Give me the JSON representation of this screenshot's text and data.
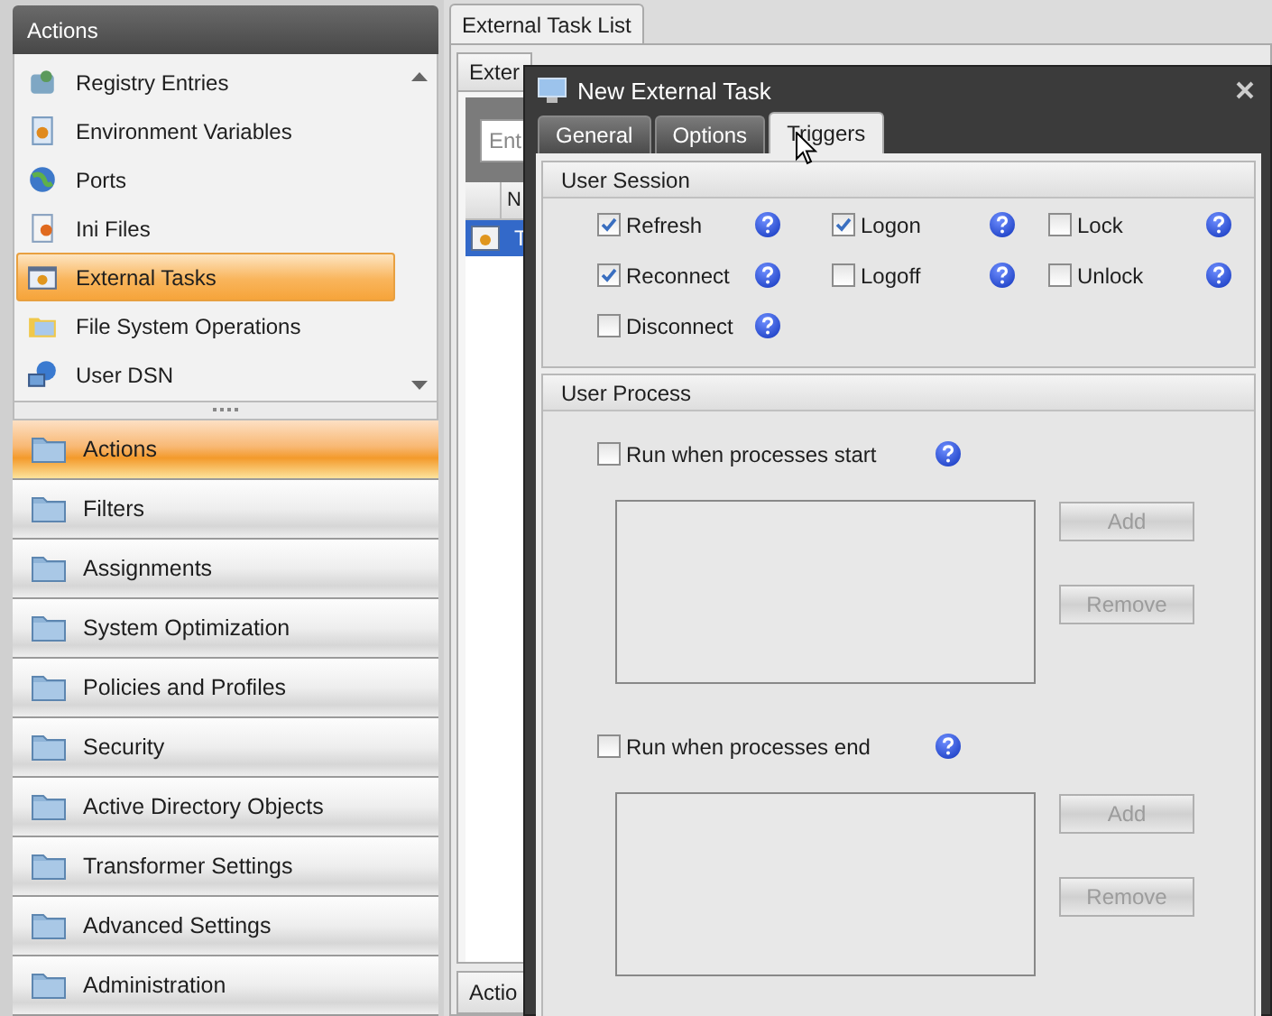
{
  "sidebar": {
    "header": "Actions",
    "items": [
      {
        "label": "Registry Entries",
        "selected": false
      },
      {
        "label": "Environment Variables",
        "selected": false
      },
      {
        "label": "Ports",
        "selected": false
      },
      {
        "label": "Ini Files",
        "selected": false
      },
      {
        "label": "External Tasks",
        "selected": true
      },
      {
        "label": "File System Operations",
        "selected": false
      },
      {
        "label": "User DSN",
        "selected": false
      }
    ],
    "nav": [
      {
        "label": "Actions",
        "selected": true
      },
      {
        "label": "Filters",
        "selected": false
      },
      {
        "label": "Assignments",
        "selected": false
      },
      {
        "label": "System Optimization",
        "selected": false
      },
      {
        "label": "Policies and Profiles",
        "selected": false
      },
      {
        "label": "Security",
        "selected": false
      },
      {
        "label": "Active Directory Objects",
        "selected": false
      },
      {
        "label": "Transformer Settings",
        "selected": false
      },
      {
        "label": "Advanced Settings",
        "selected": false
      },
      {
        "label": "Administration",
        "selected": false
      }
    ]
  },
  "main": {
    "tab": "External Task List",
    "inner_tab": "Exter",
    "search": {
      "placeholder": "Ent"
    },
    "table": {
      "columns": [
        "N"
      ],
      "rows": [
        {
          "cell": "T",
          "selected": true
        }
      ]
    },
    "bottom_tab": "Actio"
  },
  "dialog": {
    "title": "New External Task",
    "tabs": [
      {
        "label": "General",
        "selected": false
      },
      {
        "label": "Options",
        "selected": false
      },
      {
        "label": "Triggers",
        "selected": true
      }
    ],
    "user_session": {
      "title": "User Session",
      "options": [
        {
          "label": "Refresh",
          "checked": true
        },
        {
          "label": "Logon",
          "checked": true
        },
        {
          "label": "Lock",
          "checked": false
        },
        {
          "label": "Reconnect",
          "checked": true
        },
        {
          "label": "Logoff",
          "checked": false
        },
        {
          "label": "Unlock",
          "checked": false
        },
        {
          "label": "Disconnect",
          "checked": false
        }
      ]
    },
    "user_process": {
      "title": "User Process",
      "sections": [
        {
          "label": "Run when processes start",
          "checked": false,
          "buttons": [
            {
              "label": "Add",
              "disabled": true
            },
            {
              "label": "Remove",
              "disabled": true
            }
          ]
        },
        {
          "label": "Run when processes end",
          "checked": false,
          "buttons": [
            {
              "label": "Add",
              "disabled": true
            },
            {
              "label": "Remove",
              "disabled": true
            }
          ]
        }
      ]
    }
  }
}
